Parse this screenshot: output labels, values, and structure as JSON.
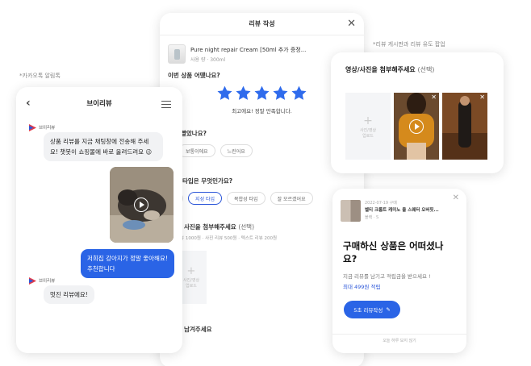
{
  "captions": {
    "kakao": "*카카오톡 알림톡",
    "board": "*리뷰 게시판과 리뷰 유도 팝업"
  },
  "review_form": {
    "title": "리뷰 작성",
    "product_name": "Pure night repair Cream [50ml 추가 증정...",
    "product_option": "사용 량 · 300ml",
    "rating_question": "이번 상품 어땠나요?",
    "rating": 5,
    "rating_caption": "최고에요! 정말 만족합니다.",
    "q_texture": "빨았나요?",
    "texture_options": [
      "어요",
      "보통이에요",
      "느린어요"
    ],
    "q_skin": "타입은 무엇인가요?",
    "skin_options": [
      "타입",
      "지성 타입",
      "복합성 타입",
      "잘 모르겠어요"
    ],
    "skin_selected": 1,
    "q_photo": "사진을 첨부해주세요",
    "q_photo_optional": "(선택)",
    "photo_points": "리뷰 1000원 · 사진 리뷰 500원 · 텍스트 리뷰 200원",
    "upload_label": "사진/영상 업로드",
    "q_text": "남겨주세요"
  },
  "chat": {
    "title": "브이리뷰",
    "bot_name": "브이리뷰",
    "msg1": "상품 리뷰를 지금 채팅창에 전송해 주세요! 챗봇이 쇼핑몰에 바로 올려드려요 😉",
    "msg2": "저희집 강아지가 정말 좋아해요! 추천합니다",
    "msg3": "멋진 리뷰에요!"
  },
  "upload_card": {
    "title": "영상/사진을 첨부해주세요",
    "optional": "(선택)",
    "upload_label": "사진/영상 업로드"
  },
  "popup": {
    "date": "2022-07-19 구매",
    "product_name": "벨티 크롭트 캐미노 울 스웨터 오버핏...",
    "option": "블랙 · S",
    "headline": "구매하신 상품은 어떠셨나요?",
    "sub": "지금 리뷰를 남기고 적립금을 받으세요 !",
    "points": "최대 499원 적립",
    "button": "5초 리뷰작성",
    "footer": "오늘 하루 보지 않기"
  },
  "colors": {
    "accent": "#2a64e6",
    "star": "#2f6bec"
  }
}
